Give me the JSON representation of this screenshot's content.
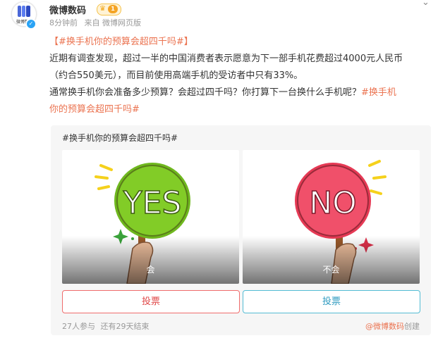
{
  "post": {
    "username": "微博数码",
    "level": "1",
    "time": "8分钟前",
    "source": "来自 微博网页版",
    "avatar_text": "微博数码",
    "line1_tag": "【#换手机你的预算会超四千吗#】",
    "line2": "近期有调查发现，超过一半的中国消费者表示愿意为下一部手机花费超过4000元人民币",
    "line3": "（约合550美元），而目前使用高端手机的受访者中只有33%。",
    "line4_text": "通常换手机你会准备多少预算？会超过四千吗？你打算下一台换什么手机呢？",
    "line4_tag_a": "#换手机",
    "line5_tag_b": "你的预算会超四千吗#"
  },
  "poll": {
    "title": "#换手机你的预算会超四千吗#",
    "options": [
      {
        "label": "会",
        "sign_text": "YES",
        "color": "#7cc424"
      },
      {
        "label": "不会",
        "sign_text": "NO",
        "color": "#f0506a"
      }
    ],
    "vote_label": "投票",
    "participants": "27人参与",
    "remaining": "还有29天结束",
    "creator_link": "@微博数码",
    "creator_suffix": "创建"
  },
  "colors": {
    "accent": "#eb7350",
    "vote_left": "#ef6c6c",
    "vote_right": "#53bcd4"
  }
}
